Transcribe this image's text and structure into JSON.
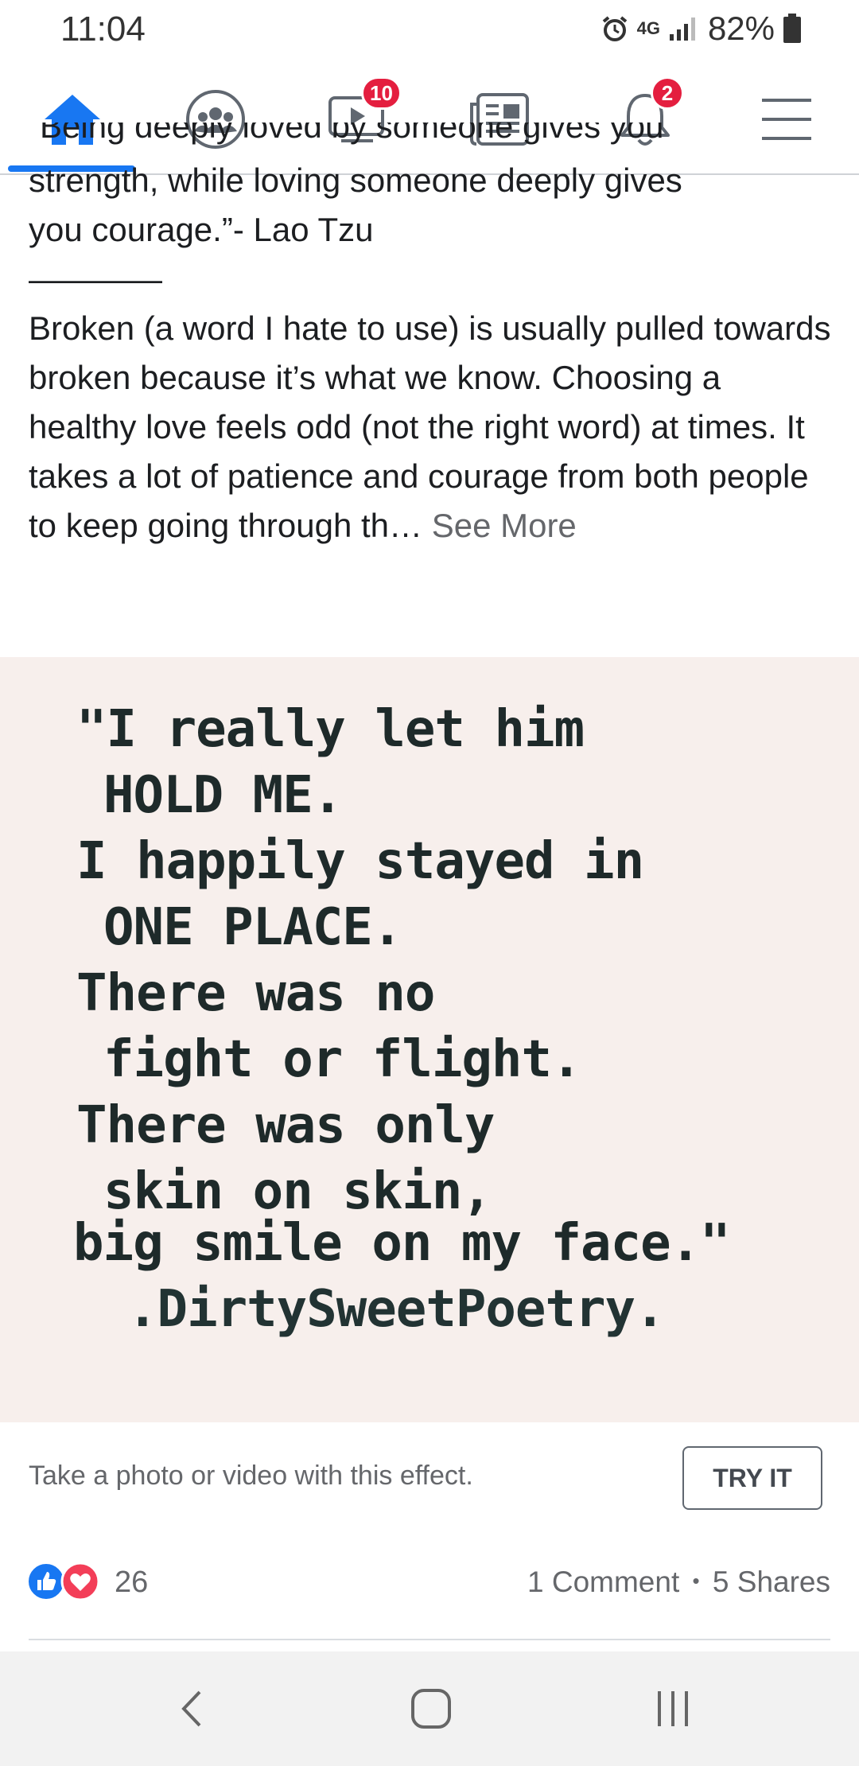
{
  "status_bar": {
    "time": "11:04",
    "network": "4G",
    "battery_percent": "82%"
  },
  "top_nav": {
    "items": [
      {
        "icon": "home-icon",
        "active": true
      },
      {
        "icon": "groups-icon",
        "active": false
      },
      {
        "icon": "watch-icon",
        "badge": "10",
        "active": false
      },
      {
        "icon": "news-icon",
        "active": false
      },
      {
        "icon": "notifications-icon",
        "badge": "2",
        "active": false
      },
      {
        "icon": "menu-icon",
        "active": false
      }
    ],
    "accent": "#1877f2",
    "badge_color": "#e41e3f"
  },
  "post": {
    "clipped_line": "“Being deeply loved by someone gives you",
    "quote_lines": [
      "strength, while loving someone deeply gives",
      "you courage.”- Lao Tzu"
    ],
    "separator": "————",
    "body": "Broken (a word I hate to use) is usually pulled towards broken because it’s what we know. Choosing a healthy love feels odd (not the right word) at times.  It takes a lot of patience and courage from both people to keep going through th…",
    "see_more": "See More"
  },
  "image": {
    "lines": [
      "\"I really let him",
      "HOLD ME.",
      "I happily stayed in",
      "ONE PLACE.",
      "There was no",
      "fight or flight.",
      "There was only",
      "skin on skin,",
      "big smile on my face.\"",
      ".DirtySweetPoetry."
    ]
  },
  "effect": {
    "text": "Take a photo or video with this effect.",
    "button": "TRY IT"
  },
  "reactions": {
    "count": "26",
    "comments": "1 Comment",
    "dot": "•",
    "shares": "5 Shares"
  },
  "system_nav": {
    "items": [
      "back-icon",
      "home-button-icon",
      "recents-icon"
    ]
  }
}
